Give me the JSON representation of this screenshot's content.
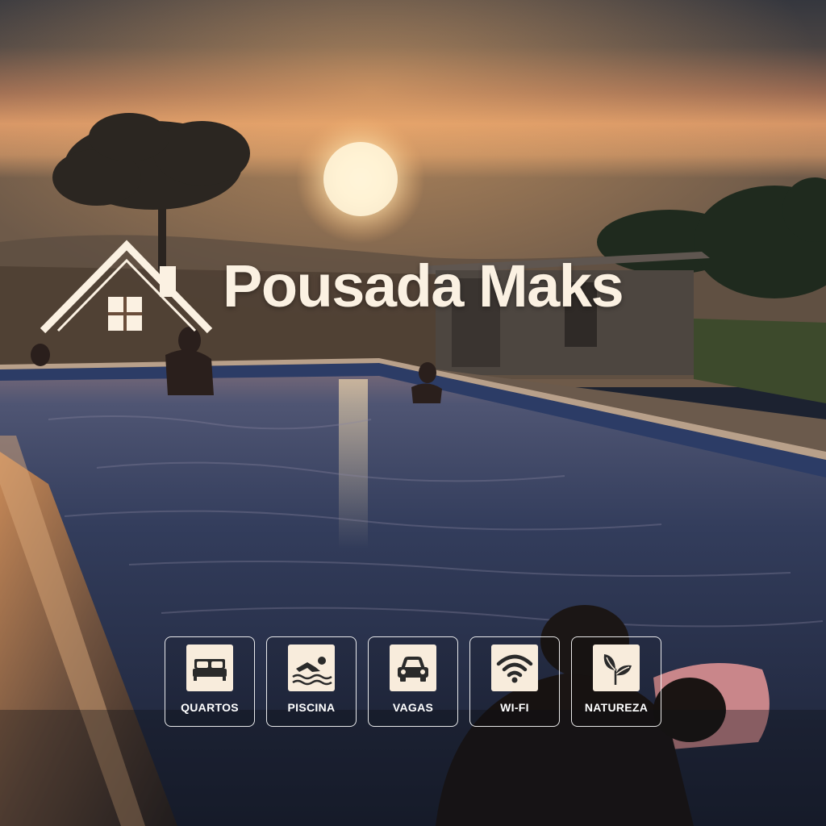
{
  "brand": {
    "name": "Pousada Maks",
    "logo_icon": "house-icon"
  },
  "colors": {
    "cream": "#fbf1e2",
    "icon_tile": "#f8ecdc",
    "icon_dark": "#2a2a2a",
    "sky_top": "#3b3d44",
    "sunset_orange": "#e08a4a",
    "pool_blue": "#2a3450"
  },
  "amenities": [
    {
      "label": "QUARTOS",
      "icon": "bed-icon"
    },
    {
      "label": "PISCINA",
      "icon": "swimmer-icon"
    },
    {
      "label": "VAGAS",
      "icon": "car-icon"
    },
    {
      "label": "WI-FI",
      "icon": "wifi-icon"
    },
    {
      "label": "NATUREZA",
      "icon": "leaf-icon"
    }
  ]
}
